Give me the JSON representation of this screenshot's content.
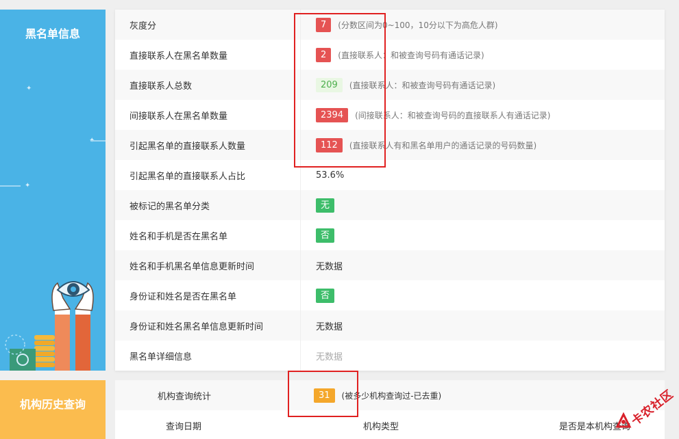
{
  "blacklist_section": {
    "title": "黑名单信息"
  },
  "history_section": {
    "title": "机构历史查询"
  },
  "rows": [
    {
      "label": "灰度分",
      "value": "7",
      "badge": "red",
      "note": "(分数区间为0~100，10分以下为高危人群)"
    },
    {
      "label": "直接联系人在黑名单数量",
      "value": "2",
      "badge": "red",
      "note": "(直接联系人：和被查询号码有通话记录)"
    },
    {
      "label": "直接联系人总数",
      "value": "209",
      "badge": "light",
      "note": "(直接联系人：和被查询号码有通话记录)"
    },
    {
      "label": "间接联系人在黑名单数量",
      "value": "2394",
      "badge": "red",
      "note": "(间接联系人：和被查询号码的直接联系人有通话记录)"
    },
    {
      "label": "引起黑名单的直接联系人数量",
      "value": "112",
      "badge": "red",
      "note": "(直接联系人有和黑名单用户的通话记录的号码数量)"
    },
    {
      "label": "引起黑名单的直接联系人占比",
      "value": "53.6%",
      "badge": "plain",
      "note": ""
    },
    {
      "label": "被标记的黑名单分类",
      "value": "无",
      "badge": "green",
      "note": ""
    },
    {
      "label": "姓名和手机是否在黑名单",
      "value": "否",
      "badge": "green",
      "note": ""
    },
    {
      "label": "姓名和手机黑名单信息更新时间",
      "value": "无数据",
      "badge": "plain",
      "note": ""
    },
    {
      "label": "身份证和姓名是否在黑名单",
      "value": "否",
      "badge": "green",
      "note": ""
    },
    {
      "label": "身份证和姓名黑名单信息更新时间",
      "value": "无数据",
      "badge": "plain",
      "note": ""
    },
    {
      "label": "黑名单详细信息",
      "value": "无数据",
      "badge": "muted",
      "note": ""
    }
  ],
  "history": {
    "stat_label": "机构查询统计",
    "stat_value": "31",
    "stat_note": "(被多少机构查询过-已去重)",
    "columns": [
      "查询日期",
      "机构类型",
      "是否是本机构查询"
    ]
  },
  "watermark": {
    "text": "卡农社区"
  },
  "colors": {
    "sidebar_blue": "#4ab3e6",
    "sidebar_orange": "#fbbc4e",
    "badge_red": "#e55353",
    "badge_green": "#3dbd6a",
    "badge_orange": "#f4a72b",
    "highlight_box": "#e02020"
  },
  "icons": [
    "eye-icon",
    "hands-icon",
    "coin-stack-icon",
    "safe-icon",
    "kanong-logo-icon"
  ]
}
